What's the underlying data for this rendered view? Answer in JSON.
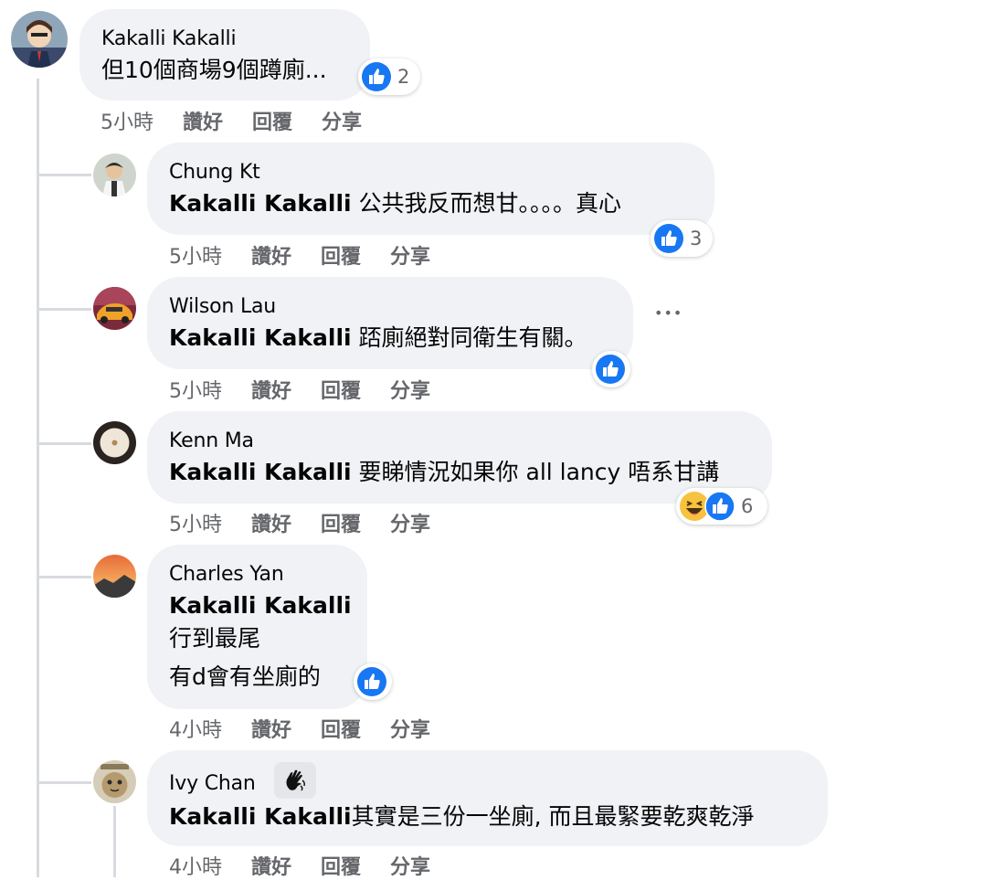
{
  "root_comment": {
    "author": "Kakalli Kakalli",
    "text": "但10個商場9個蹲廁...",
    "reaction_count": "2",
    "time": "5小時",
    "like_label": "讚好",
    "reply_label": "回覆",
    "share_label": "分享"
  },
  "replies": [
    {
      "author": "Chung Kt",
      "mention": "Kakalli Kakalli",
      "text": " 公共我反而想甘。。。。真心",
      "reaction_count": "3",
      "time": "5小時",
      "like_label": "讚好",
      "reply_label": "回覆",
      "share_label": "分享"
    },
    {
      "author": "Wilson Lau",
      "mention": "Kakalli Kakalli",
      "text": " 踎廁絕對同衛生有關。",
      "reaction_count": "",
      "more": "•••",
      "time": "5小時",
      "like_label": "讚好",
      "reply_label": "回覆",
      "share_label": "分享"
    },
    {
      "author": "Kenn Ma",
      "mention": "Kakalli Kakalli",
      "text": " 要睇情況如果你 all lancy 唔系甘講",
      "reaction_count": "6",
      "time": "5小時",
      "like_label": "讚好",
      "reply_label": "回覆",
      "share_label": "分享"
    },
    {
      "author": "Charles Yan",
      "mention": "Kakalli Kakalli",
      "line2": "行到最尾",
      "line3": "有d會有坐廁的",
      "reaction_count": "",
      "time": "4小時",
      "like_label": "讚好",
      "reply_label": "回覆",
      "share_label": "分享"
    },
    {
      "author": "Ivy Chan",
      "mention": "Kakalli Kakalli",
      "text": "其實是三份一坐廁, 而且最緊要乾爽乾淨",
      "reaction_count": "",
      "time": "4小時",
      "like_label": "讚好",
      "reply_label": "回覆",
      "share_label": "分享"
    }
  ],
  "colors": {
    "bubble": "#f0f2f5",
    "like_blue": "#1877f2",
    "meta_gray": "#65676b",
    "thread_line": "#d8dadf"
  }
}
